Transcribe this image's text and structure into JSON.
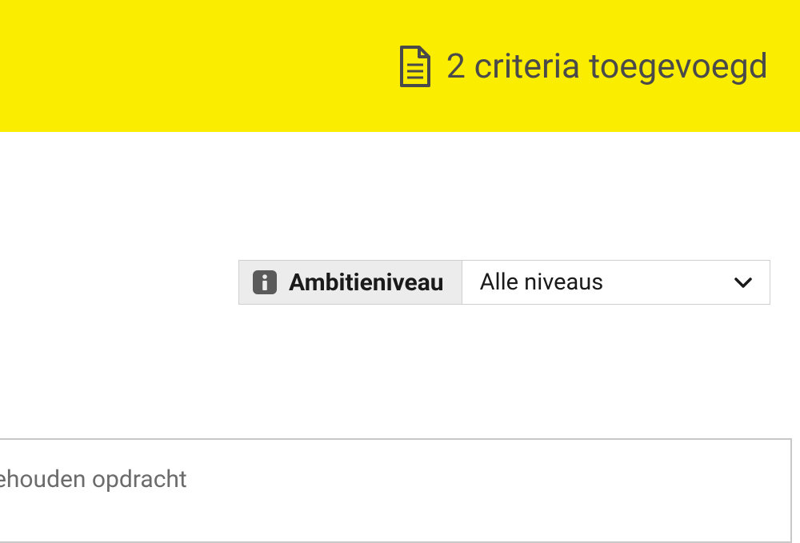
{
  "header": {
    "criteria_text": "2 criteria toegevoegd"
  },
  "filter": {
    "label": "Ambitieniveau",
    "selected_value": "Alle niveaus"
  },
  "bottom": {
    "text": "ehouden opdracht"
  }
}
